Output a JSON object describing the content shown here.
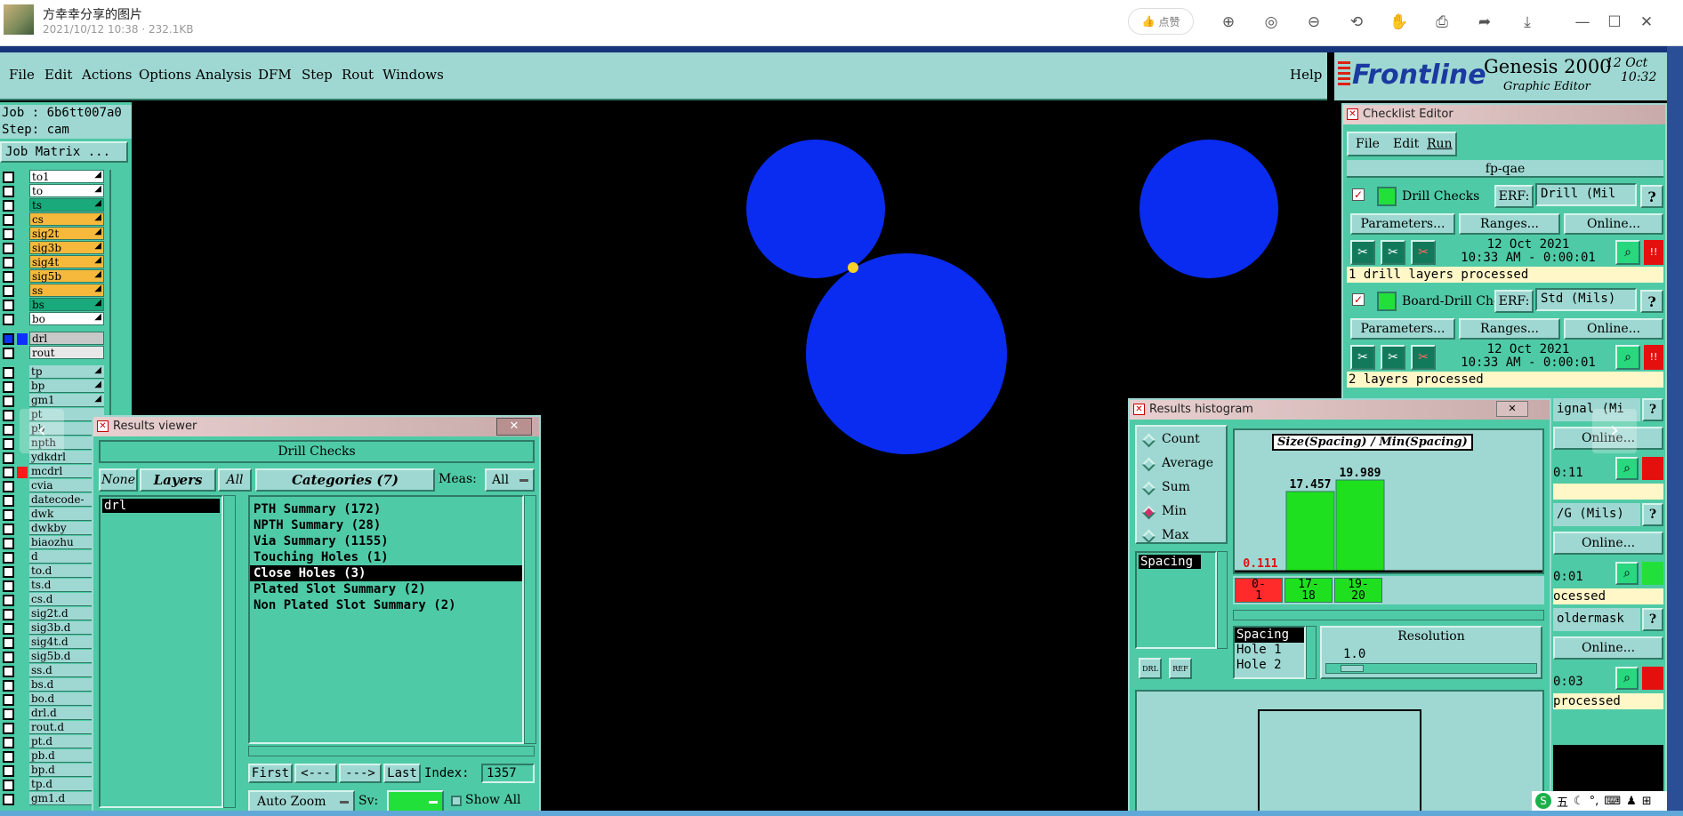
{
  "viewer": {
    "title": "方幸幸分享的图片",
    "meta": "2021/10/12 10:38 · 232.1KB",
    "like": "点赞"
  },
  "menubar": {
    "items": [
      "File",
      "Edit",
      "Actions",
      "Options",
      "Analysis",
      "DFM",
      "Step",
      "Rout",
      "Windows"
    ],
    "help": "Help"
  },
  "brand": {
    "logo": "Frontline",
    "product": "Genesis 2000",
    "subtitle": "Graphic Editor",
    "date": "12 Oct",
    "time": "10:32"
  },
  "job": {
    "job_line": "Job : 6b6tt007a0",
    "step_line": "Step: cam",
    "matrix_button": "Job Matrix ..."
  },
  "layers": [
    {
      "name": "to1",
      "color": "#ffffff"
    },
    {
      "name": "to",
      "color": "#ffffff"
    },
    {
      "name": "ts",
      "color": "#19a97a"
    },
    {
      "name": "cs",
      "color": "#f6b93c"
    },
    {
      "name": "sig2t",
      "color": "#f6b93c"
    },
    {
      "name": "sig3b",
      "color": "#f6b93c"
    },
    {
      "name": "sig4t",
      "color": "#f6b93c"
    },
    {
      "name": "sig5b",
      "color": "#f6b93c"
    },
    {
      "name": "ss",
      "color": "#f6b93c"
    },
    {
      "name": "bs",
      "color": "#19a97a"
    },
    {
      "name": "bo",
      "color": "#ffffff"
    },
    {
      "name": "drl",
      "color": "#c8c8c8"
    },
    {
      "name": "rout",
      "color": "#e8e8e8"
    },
    {
      "name": "tp",
      "color": "#9fd8d2"
    },
    {
      "name": "bp",
      "color": "#9fd8d2"
    },
    {
      "name": "gm1",
      "color": "#9fd8d2"
    },
    {
      "name": "pt",
      "color": "#9fd8d2"
    },
    {
      "name": "pb",
      "color": "#9fd8d2"
    },
    {
      "name": "npth",
      "color": "#9fd8d2"
    },
    {
      "name": "ydkdrl",
      "color": "#9fd8d2"
    },
    {
      "name": "mcdrl",
      "color": "#9fd8d2"
    },
    {
      "name": "cvia",
      "color": "#9fd8d2"
    },
    {
      "name": "datecode-",
      "color": "#9fd8d2"
    },
    {
      "name": "dwk",
      "color": "#9fd8d2"
    },
    {
      "name": "dwkby",
      "color": "#9fd8d2"
    },
    {
      "name": "biaozhu",
      "color": "#9fd8d2"
    },
    {
      "name": "d",
      "color": "#9fd8d2"
    },
    {
      "name": "to.d",
      "color": "#9fd8d2"
    },
    {
      "name": "ts.d",
      "color": "#9fd8d2"
    },
    {
      "name": "cs.d",
      "color": "#9fd8d2"
    },
    {
      "name": "sig2t.d",
      "color": "#9fd8d2"
    },
    {
      "name": "sig3b.d",
      "color": "#9fd8d2"
    },
    {
      "name": "sig4t.d",
      "color": "#9fd8d2"
    },
    {
      "name": "sig5b.d",
      "color": "#9fd8d2"
    },
    {
      "name": "ss.d",
      "color": "#9fd8d2"
    },
    {
      "name": "bs.d",
      "color": "#9fd8d2"
    },
    {
      "name": "bo.d",
      "color": "#9fd8d2"
    },
    {
      "name": "drl.d",
      "color": "#9fd8d2"
    },
    {
      "name": "rout.d",
      "color": "#9fd8d2"
    },
    {
      "name": "pt.d",
      "color": "#9fd8d2"
    },
    {
      "name": "pb.d",
      "color": "#9fd8d2"
    },
    {
      "name": "bp.d",
      "color": "#9fd8d2"
    },
    {
      "name": "tp.d",
      "color": "#9fd8d2"
    },
    {
      "name": "gm1.d",
      "color": "#9fd8d2"
    }
  ],
  "results_viewer": {
    "title": "Results viewer",
    "header": "Drill Checks",
    "none": "None",
    "layers_label": "Layers",
    "all": "All",
    "categories": "Categories (7)",
    "meas_label": "Meas:",
    "meas_value": "All",
    "layer_list": [
      "drl"
    ],
    "category_list": [
      "PTH Summary (172)",
      "NPTH Summary (28)",
      "Via Summary (1155)",
      "Touching Holes (1)",
      "Close Holes (3)",
      "Plated Slot Summary (2)",
      "Non Plated Slot Summary (2)"
    ],
    "first": "First",
    "prev": "<---",
    "next": "--->",
    "last": "Last",
    "index_label": "Index:",
    "index_value": "1357",
    "auto_zoom": "Auto Zoom",
    "sv_label": "Sv:",
    "show_all": "Show All"
  },
  "checklist": {
    "title": "Checklist Editor",
    "menu": [
      "File",
      "Edit",
      "Run"
    ],
    "name": "fp-qae",
    "checks": [
      {
        "name": "Drill Checks",
        "erf_label": "ERF:",
        "erf": "Drill (Mil",
        "params": "Parameters...",
        "ranges": "Ranges...",
        "online": "Online...",
        "date": "12 Oct 2021",
        "time": "10:33 AM - 0:00:01",
        "status": "1 drill layers processed"
      },
      {
        "name": "Board-Drill Che",
        "erf_label": "ERF:",
        "erf": "Std (Mils)",
        "params": "Parameters...",
        "ranges": "Ranges...",
        "online": "Online...",
        "date": "12 Oct 2021",
        "time": "10:33 AM - 0:00:01",
        "status": "2 layers processed"
      }
    ],
    "partial": {
      "erf3": "ignal (Mi",
      "online": "Online...",
      "time3": "0:11",
      "erf4": "/G (Mils)",
      "time4": "0:01",
      "status4": "ocessed",
      "erf5": "oldermask",
      "time5": "0:03",
      "status5": "processed"
    }
  },
  "histogram": {
    "title": "Results histogram",
    "options": [
      "Count",
      "Average",
      "Sum",
      "Min",
      "Max"
    ],
    "selected": "Min",
    "attr_list": [
      "Spacing"
    ],
    "chart_title": "Size(Spacing) / Min(Spacing)",
    "attr_list2": [
      "Spacing",
      "Hole 1",
      "Hole 2"
    ],
    "resolution_label": "Resolution",
    "resolution_value": "1.0",
    "bin_labels": [
      [
        "0-",
        "1"
      ],
      [
        "17-",
        "18"
      ],
      [
        "19-",
        "20"
      ]
    ],
    "chart_data": {
      "type": "bar",
      "title": "Size(Spacing) / Min(Spacing)",
      "categories": [
        "0-1",
        "17-18",
        "19-20"
      ],
      "values": [
        0.111,
        17.457,
        19.989
      ],
      "colors": [
        "#ff2a2a",
        "#1fe01f",
        "#1fe01f"
      ]
    }
  },
  "taskbar": {
    "glyphs": "五"
  }
}
